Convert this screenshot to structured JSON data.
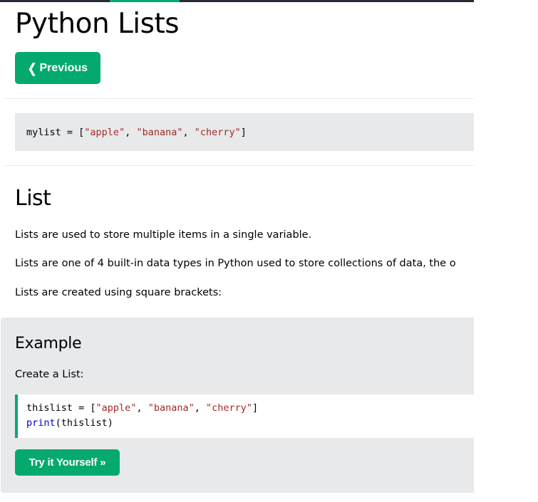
{
  "colors": {
    "accent": "#04aa6d",
    "code_bg": "#e7e9eb",
    "string": "#a52a2a",
    "keyword": "#0000cd",
    "topbar": "#282a35"
  },
  "header": {
    "title": "Python Lists",
    "prev_button": {
      "icon": "chevron-left-icon",
      "label": "Previous"
    }
  },
  "snippet": {
    "var": "mylist",
    "op": " = [",
    "items": [
      "\"apple\"",
      "\"banana\"",
      "\"cherry\""
    ],
    "sep": ", ",
    "close": "]"
  },
  "section": {
    "title": "List",
    "paragraphs": [
      "Lists are used to store multiple items in a single variable.",
      "Lists are one of 4 built-in data types in Python used to store collections of data, the o",
      "Lists are created using square brackets:"
    ]
  },
  "example": {
    "title": "Example",
    "subtitle": "Create a List:",
    "line1": {
      "var": "thislist",
      "op": " = [",
      "items": [
        "\"apple\"",
        "\"banana\"",
        "\"cherry\""
      ],
      "sep": ", ",
      "close": "]"
    },
    "line2": {
      "fn": "print",
      "args": "(thislist)"
    },
    "try_button": "Try it Yourself »"
  }
}
